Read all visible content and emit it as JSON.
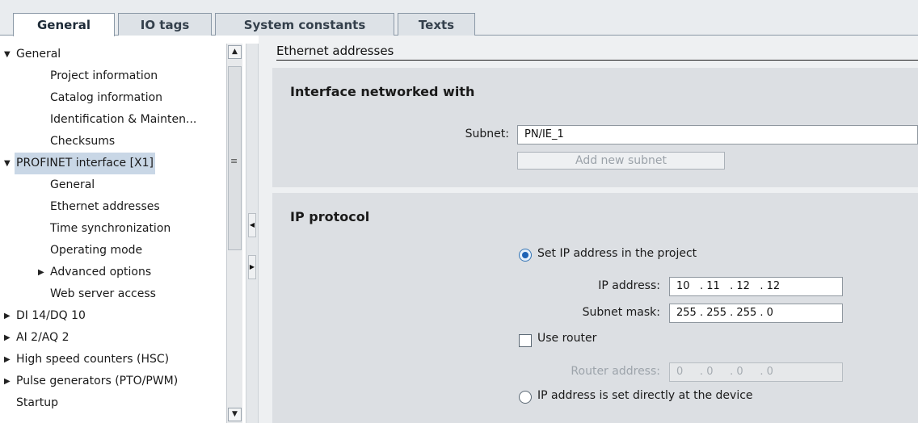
{
  "tabs": [
    {
      "label": "General",
      "active": true
    },
    {
      "label": "IO tags",
      "active": false
    },
    {
      "label": "System constants",
      "active": false
    },
    {
      "label": "Texts",
      "active": false
    }
  ],
  "tree": {
    "items": [
      {
        "label": "General",
        "expanded": true
      },
      {
        "label": "Project information"
      },
      {
        "label": "Catalog information"
      },
      {
        "label": "Identification & Mainten..."
      },
      {
        "label": "Checksums"
      },
      {
        "label": "PROFINET interface [X1]",
        "expanded": true,
        "selected": true
      },
      {
        "label": "General"
      },
      {
        "label": "Ethernet addresses"
      },
      {
        "label": "Time synchronization"
      },
      {
        "label": "Operating mode"
      },
      {
        "label": "Advanced options",
        "expanded": false
      },
      {
        "label": "Web server access"
      },
      {
        "label": "DI 14/DQ 10",
        "expanded": false
      },
      {
        "label": "AI 2/AQ 2",
        "expanded": false
      },
      {
        "label": "High speed counters (HSC)",
        "expanded": false
      },
      {
        "label": "Pulse generators (PTO/PWM)",
        "expanded": false
      },
      {
        "label": "Startup"
      }
    ]
  },
  "content": {
    "section_title": "Ethernet addresses",
    "interface_panel": {
      "title": "Interface networked with",
      "subnet_label": "Subnet:",
      "subnet_value": "PN/IE_1",
      "add_subnet_button": "Add new subnet"
    },
    "ip_panel": {
      "title": "IP protocol",
      "option_set_in_project": "Set IP address in the project",
      "ip_label": "IP address:",
      "ip_value": "10   . 11   . 12   . 12",
      "mask_label": "Subnet mask:",
      "mask_value": "255 . 255 . 255 . 0",
      "use_router_label": "Use router",
      "use_router_checked": false,
      "router_label": "Router address:",
      "router_value": "0     . 0     . 0     . 0",
      "option_set_at_device": "IP address is set directly at the device",
      "selected_option": "Set IP address in the project"
    }
  },
  "colors": {
    "tab_strip": "#e9ecef",
    "content_bg": "#eef0f2",
    "panel_bg": "#dcdfe3",
    "selection": "#c9d7e6",
    "radio_selected": "#1e63b6"
  }
}
